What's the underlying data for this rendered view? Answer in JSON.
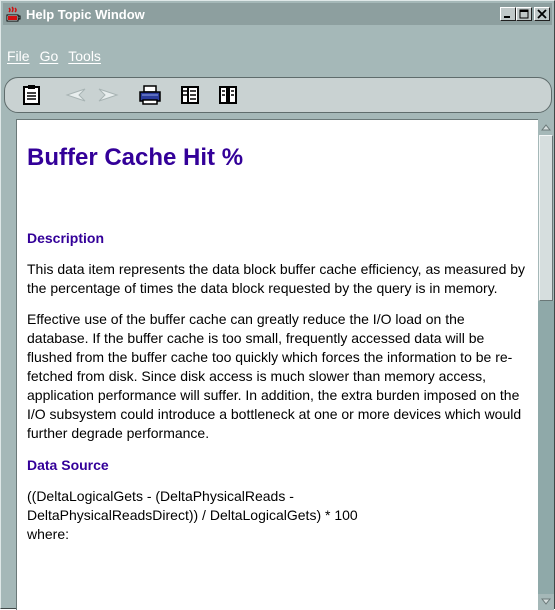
{
  "window": {
    "title": "Help Topic Window",
    "minimize_label": "_",
    "maximize_label": "□",
    "close_label": "X"
  },
  "menu": {
    "items": [
      {
        "label": "File"
      },
      {
        "label": "Go"
      },
      {
        "label": "Tools"
      }
    ]
  },
  "toolbar": {
    "icons": [
      "contents-icon",
      "back-arrow-icon",
      "forward-arrow-icon",
      "print-icon",
      "split-view-icon",
      "dual-pane-icon"
    ]
  },
  "content": {
    "title": "Buffer Cache Hit %",
    "description_heading": "Description",
    "description_p1": "This data item represents the data block buffer cache efficiency, as measured by the percentage of times the data block requested by the query is in memory.",
    "description_p2": "Effective use of the buffer cache can greatly reduce the I/O load on the database. If the buffer cache is too small, frequently accessed data will be flushed from the buffer cache too quickly which forces the information to be re-fetched from disk. Since disk access is much slower than memory access, application performance will suffer. In addition, the extra burden imposed on the I/O subsystem could introduce a bottleneck at one or more devices which would further degrade performance.",
    "datasource_heading": "Data Source",
    "datasource_formula_line1": "((DeltaLogicalGets - (DeltaPhysicalReads -",
    "datasource_formula_line2": "DeltaPhysicalReadsDirect)) / DeltaLogicalGets) * 100",
    "datasource_formula_line3": "where:"
  },
  "colors": {
    "heading": "#330099",
    "chrome": "#a5b8b8",
    "titlebar": "#8d9f9f"
  }
}
